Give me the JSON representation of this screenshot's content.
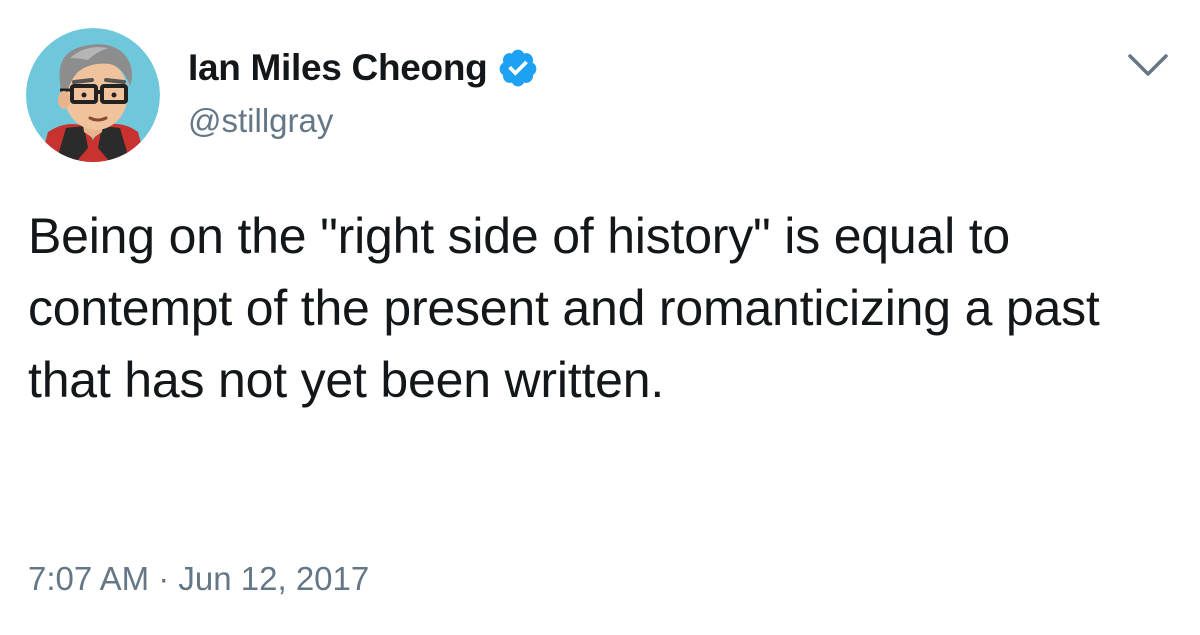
{
  "tweet": {
    "author": {
      "display_name": "Ian Miles Cheong",
      "handle": "@stillgray",
      "verified": true,
      "avatar_icon": "cartoon-portrait-avatar"
    },
    "text": "Being on the \"right side of history\" is equal to contempt of the present and romanticizing a past that has not yet been written.",
    "timestamp": "7:07 AM · Jun 12, 2017",
    "menu_icon": "chevron-down-icon"
  },
  "colors": {
    "verified_blue": "#1da1f2",
    "secondary_text": "#657786",
    "primary_text": "#14171a",
    "avatar_background": "#6fc7dc"
  }
}
